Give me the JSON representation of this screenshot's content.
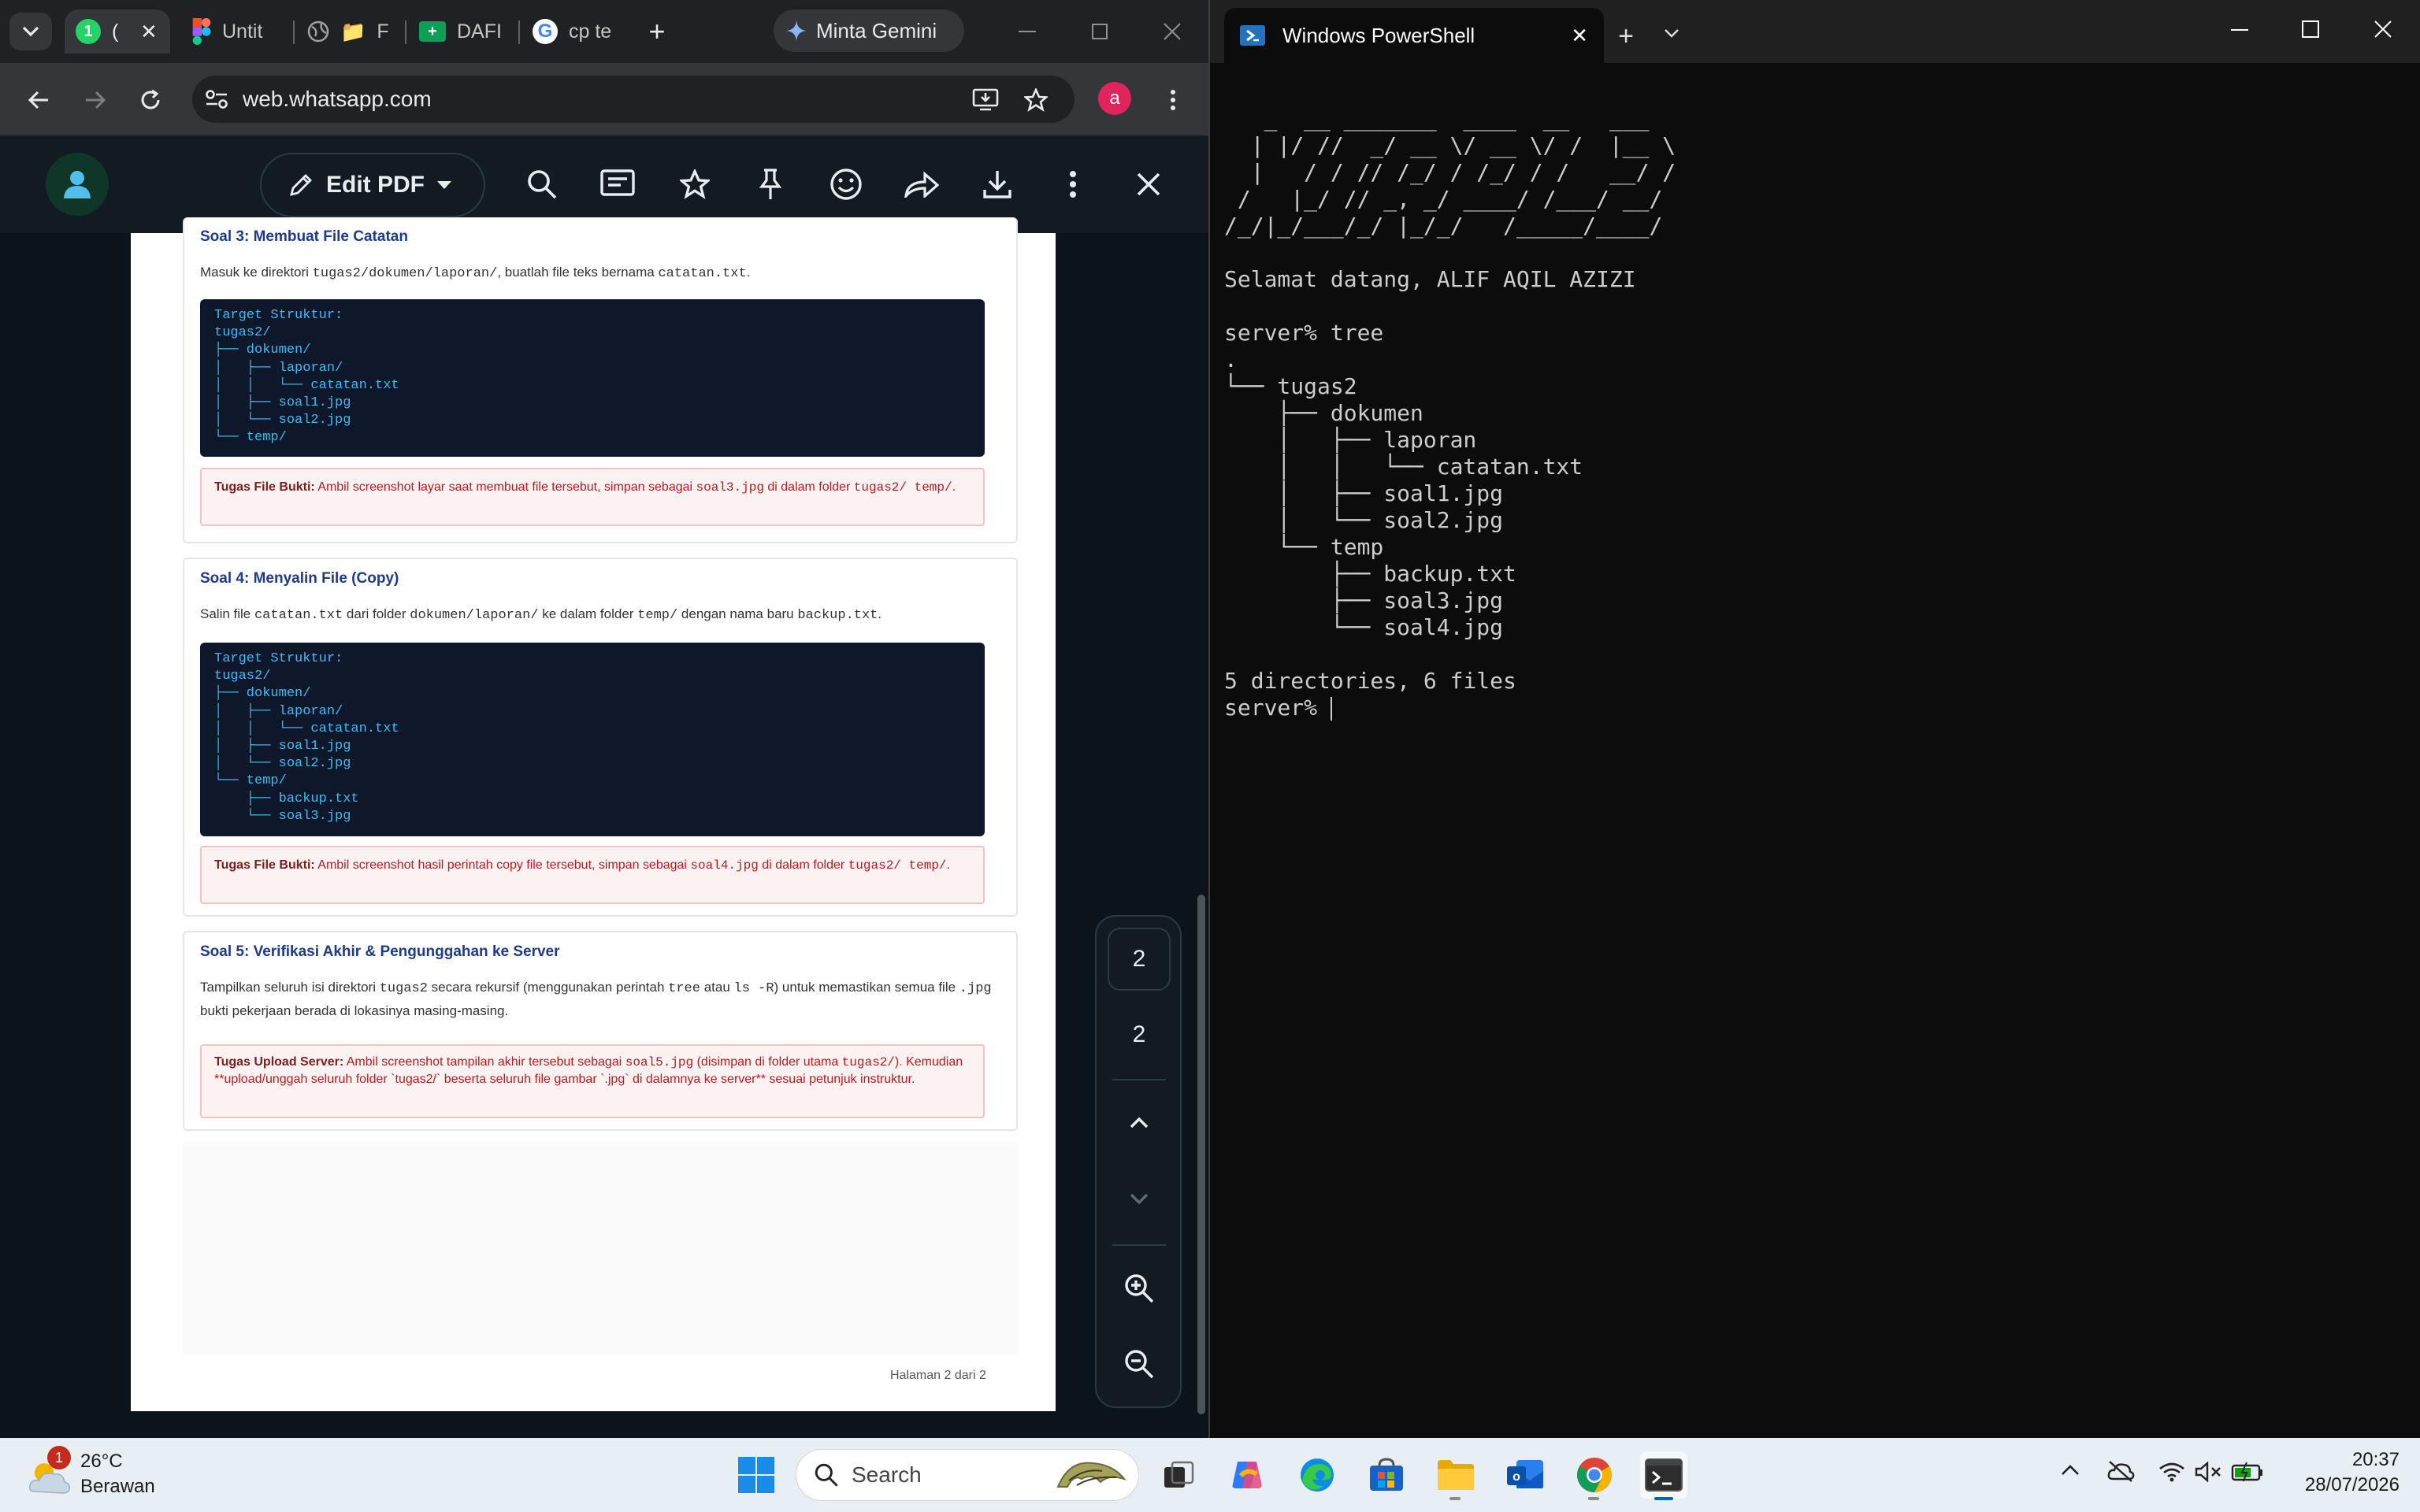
{
  "browser": {
    "tabs": [
      {
        "label": "(",
        "badge": "1"
      },
      {
        "label": "Untit"
      },
      {
        "label": "F"
      },
      {
        "label": "DAFI"
      },
      {
        "label": "cp te"
      }
    ],
    "gemini_label": "Minta Gemini",
    "url": "web.whatsapp.com",
    "profile_initial": "a"
  },
  "pdf": {
    "edit_label": "Edit PDF",
    "sections": [
      {
        "title": "Soal 3: Membuat File Catatan",
        "desc": {
          "pre": "Masuk ke direktori ",
          "c1": "tugas2/dokumen/laporan/",
          "mid": ", buatlah file teks bernama ",
          "c2": "catatan.txt",
          "post": "."
        },
        "code": [
          "Target Struktur:",
          "tugas2/",
          "├── dokumen/",
          "│   ├── laporan/",
          "│   │   └── catatan.txt",
          "│   ├── soal1.jpg",
          "│   └── soal2.jpg",
          "└── temp/"
        ],
        "alert": {
          "label": "Tugas File Bukti:",
          "pre": " Ambil screenshot layar saat membuat file tersebut, simpan sebagai ",
          "c1": "soal3.jpg",
          "mid": " di dalam folder ",
          "c2": "tugas2/ temp/",
          "post": "."
        }
      },
      {
        "title": "Soal 4: Menyalin File (Copy)",
        "desc": {
          "pre": "Salin file ",
          "c1": "catatan.txt",
          "mid": " dari folder ",
          "c2": "dokumen/laporan/",
          "mid2": " ke dalam folder ",
          "c3": "temp/",
          "mid3": " dengan nama baru ",
          "c4": "backup.txt",
          "post": "."
        },
        "code": [
          "Target Struktur:",
          "tugas2/",
          "├── dokumen/",
          "│   ├── laporan/",
          "│   │   └── catatan.txt",
          "│   ├── soal1.jpg",
          "│   └── soal2.jpg",
          "└── temp/",
          "    ├── backup.txt",
          "    └── soal3.jpg"
        ],
        "alert": {
          "label": "Tugas File Bukti:",
          "pre": " Ambil screenshot hasil perintah copy file tersebut, simpan sebagai ",
          "c1": "soal4.jpg",
          "mid": " di dalam folder ",
          "c2": "tugas2/ temp/",
          "post": "."
        }
      },
      {
        "title": "Soal 5: Verifikasi Akhir & Pengunggahan ke Server",
        "desc": {
          "pre": "Tampilkan seluruh isi direktori ",
          "c1": "tugas2",
          "mid": " secara rekursif (menggunakan perintah ",
          "c2": "tree",
          "mid2": " atau ",
          "c3": "ls -R",
          "mid3": ") untuk memastikan semua file ",
          "c4": ".jpg",
          "post": " bukti pekerjaan berada di lokasinya masing-masing."
        },
        "alert": {
          "label": "Tugas Upload Server:",
          "pre": " Ambil screenshot tampilan akhir tersebut sebagai ",
          "c1": "soal5.jpg",
          "mid": " (disimpan di folder utama ",
          "c2": "tugas2/",
          "post": "). Kemudian **upload/unggah seluruh folder `tugas2/` beserta seluruh file gambar `.jpg` di dalamnya ke server** sesuai petunjuk instruktur."
        }
      }
    ],
    "footer": "Halaman 2 dari 2",
    "current_page": "2",
    "total_pages": "2"
  },
  "powershell": {
    "title": "Windows PowerShell",
    "ascii_art": "   _  __ _______  ____  __   ___\n  | |/ //  _/ __ \\/ __ \\/ /  |__ \\\n  |   / / // /_/ / /_/ / /   __/ /\n /   |_/ // _, _/ ____/ /___/ __/\n/_/|_/___/_/ |_/_/   /_____/____/",
    "greeting": "Selamat datang, ALIF AQIL AZIZI",
    "command_line": "server% tree",
    "tree_output": ".\n└── tugas2\n    ├── dokumen\n    │   ├── laporan\n    │   │   └── catatan.txt\n    │   ├── soal1.jpg\n    │   └── soal2.jpg\n    └── temp\n        ├── backup.txt\n        ├── soal3.jpg\n        └── soal4.jpg",
    "summary": "5 directories, 6 files",
    "prompt": "server% "
  },
  "taskbar": {
    "weather_temp": "26°C",
    "weather_desc": "Berawan",
    "weather_badge": "1",
    "search_placeholder": "Search",
    "time": "20:37",
    "date": "28/07/2026"
  }
}
